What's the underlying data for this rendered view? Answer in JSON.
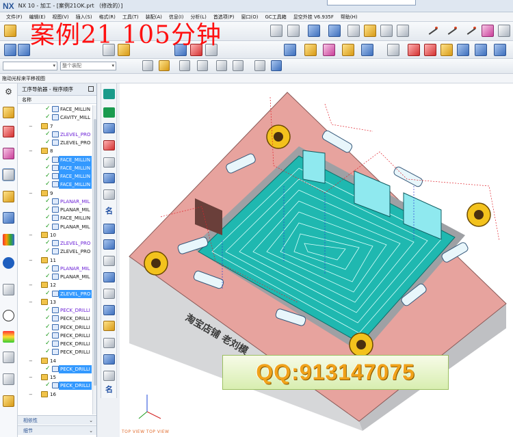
{
  "window": {
    "logo": "NX",
    "title": "NX 10 - 加工 - [案例21OK.prt （修改的）]"
  },
  "overlay_title": "案例21  105分钟",
  "menu": [
    "文件(F)",
    "编辑(E)",
    "视图(V)",
    "插入(S)",
    "格式(R)",
    "工具(T)",
    "装配(A)",
    "信息(I)",
    "分析(L)",
    "首选项(P)",
    "窗口(O)",
    "GC工具箱",
    "显空外挂 V6.935F",
    "帮助(H)"
  ],
  "toolbar": {
    "selection_filter_placeholder": "",
    "assembly_scope_placeholder": "整个装配"
  },
  "status_line": "拖动光标来平移视图",
  "navigator": {
    "title": "工序导航器 - 程序顺序",
    "column_header": "名称",
    "rows": [
      {
        "kind": "op",
        "name": "FACE_MILLIN",
        "selected": false,
        "purple": false
      },
      {
        "kind": "op",
        "name": "CAVITY_MILL",
        "selected": false,
        "purple": false
      },
      {
        "kind": "group",
        "label": "7"
      },
      {
        "kind": "op",
        "name": "ZLEVEL_PRO",
        "selected": false,
        "purple": true
      },
      {
        "kind": "op",
        "name": "ZLEVEL_PRO",
        "selected": false,
        "purple": false
      },
      {
        "kind": "group",
        "label": "8"
      },
      {
        "kind": "op",
        "name": "FACE_MILLIN",
        "selected": true,
        "purple": false
      },
      {
        "kind": "op",
        "name": "FACE_MILLIN",
        "selected": true,
        "purple": false
      },
      {
        "kind": "op",
        "name": "FACE_MILLIN",
        "selected": true,
        "purple": false
      },
      {
        "kind": "op",
        "name": "FACE_MILLIN",
        "selected": true,
        "purple": false
      },
      {
        "kind": "group",
        "label": "9"
      },
      {
        "kind": "op",
        "name": "PLANAR_MIL",
        "selected": false,
        "purple": true
      },
      {
        "kind": "op",
        "name": "PLANAR_MIL",
        "selected": false,
        "purple": false
      },
      {
        "kind": "op",
        "name": "FACE_MILLIN",
        "selected": false,
        "purple": false
      },
      {
        "kind": "op",
        "name": "PLANAR_MIL",
        "selected": false,
        "purple": false
      },
      {
        "kind": "group",
        "label": "10"
      },
      {
        "kind": "op",
        "name": "ZLEVEL_PRO",
        "selected": false,
        "purple": true
      },
      {
        "kind": "op",
        "name": "ZLEVEL_PRO",
        "selected": false,
        "purple": false
      },
      {
        "kind": "group",
        "label": "11"
      },
      {
        "kind": "op",
        "name": "PLANAR_MIL",
        "selected": false,
        "purple": true
      },
      {
        "kind": "op",
        "name": "PLANAR_MIL",
        "selected": false,
        "purple": false
      },
      {
        "kind": "group",
        "label": "12"
      },
      {
        "kind": "op",
        "name": "ZLEVEL_PRO",
        "selected": true,
        "purple": false
      },
      {
        "kind": "group",
        "label": "13"
      },
      {
        "kind": "op",
        "name": "PECK_DRILLI",
        "selected": false,
        "purple": true
      },
      {
        "kind": "op",
        "name": "PECK_DRILLI",
        "selected": false,
        "purple": false
      },
      {
        "kind": "op",
        "name": "PECK_DRILLI",
        "selected": false,
        "purple": false
      },
      {
        "kind": "op",
        "name": "PECK_DRILLI",
        "selected": false,
        "purple": false
      },
      {
        "kind": "op",
        "name": "PECK_DRILLI",
        "selected": false,
        "purple": false
      },
      {
        "kind": "op",
        "name": "PECK_DRILLI",
        "selected": false,
        "purple": false
      },
      {
        "kind": "group",
        "label": "14"
      },
      {
        "kind": "op",
        "name": "PECK_DRILLI",
        "selected": true,
        "purple": false
      },
      {
        "kind": "group",
        "label": "15"
      },
      {
        "kind": "op",
        "name": "PECK_DRILLI",
        "selected": true,
        "purple": false
      },
      {
        "kind": "group",
        "label": "16"
      }
    ],
    "footer": [
      "相依性",
      "细节"
    ]
  },
  "graphics": {
    "engraving": "淘宝店铺  老刘模",
    "watermark": "QQ:913147075",
    "view_label": "TOP VIEW    TOP VIEW",
    "colors": {
      "pink_top": "#e7a39e",
      "cyan_floor": "#1fb8b0",
      "grey_body": "#cfd0d2",
      "bushing": "#f3c21d"
    }
  },
  "icons": {
    "resource_bar": [
      "gear-icon",
      "assembly-navigator-icon",
      "constraint-navigator-icon",
      "part-navigator-icon",
      "operation-navigator-icon",
      "machine-tool-icon",
      "reuse-library-icon",
      "hd3d-tools-icon",
      "web-browser-icon",
      "history-icon",
      "system-materials-icon",
      "process-studio-icon",
      "roles-icon",
      "palette-icon"
    ]
  }
}
